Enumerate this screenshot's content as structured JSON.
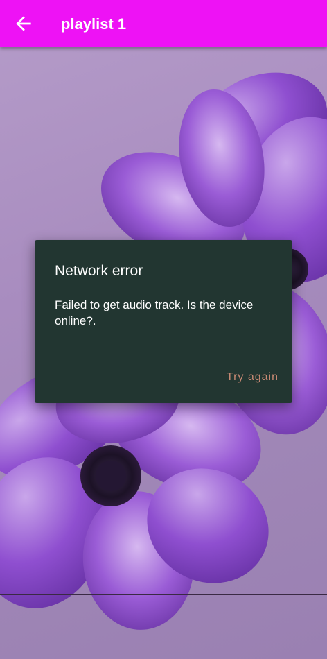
{
  "app_bar": {
    "title": "playlist 1",
    "back_icon": "arrow-left-icon",
    "color": "#ee12f5"
  },
  "dialog": {
    "title": "Network error",
    "message": "Failed to get audio track. Is the device online?.",
    "action_label": "Try again",
    "background_color": "#223631",
    "action_color": "#c98a74"
  },
  "background": {
    "description_icon": "purple-flowers-wallpaper"
  }
}
